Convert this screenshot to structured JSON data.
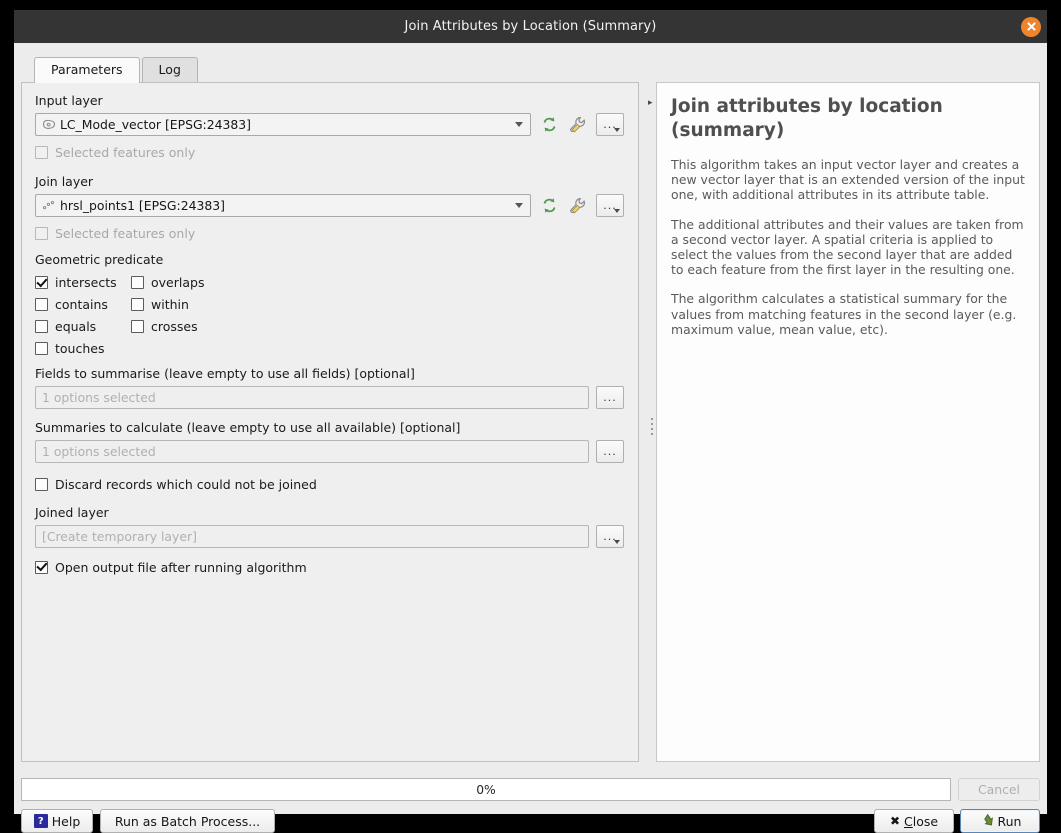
{
  "window": {
    "title": "Join Attributes by Location (Summary)",
    "close_icon": "close-icon"
  },
  "tabs": [
    {
      "label": "Parameters",
      "active": true
    },
    {
      "label": "Log",
      "active": false
    }
  ],
  "parameters": {
    "input_layer": {
      "label": "Input layer",
      "value": "LC_Mode_vector [EPSG:24383]",
      "layer_icon": "polygon-layer-icon",
      "refresh_icon": "refresh-icon",
      "wrench_icon": "wrench-icon",
      "more_label": "..."
    },
    "input_selected_only": {
      "label": "Selected features only",
      "checked": false,
      "disabled": true
    },
    "join_layer": {
      "label": "Join layer",
      "value": "hrsl_points1 [EPSG:24383]",
      "layer_icon": "point-layer-icon",
      "refresh_icon": "refresh-icon",
      "wrench_icon": "wrench-icon",
      "more_label": "..."
    },
    "join_selected_only": {
      "label": "Selected features only",
      "checked": false,
      "disabled": true
    },
    "geometric_predicate": {
      "label": "Geometric predicate",
      "options": [
        {
          "label": "intersects",
          "checked": true
        },
        {
          "label": "overlaps",
          "checked": false
        },
        {
          "label": "contains",
          "checked": false
        },
        {
          "label": "within",
          "checked": false
        },
        {
          "label": "equals",
          "checked": false
        },
        {
          "label": "crosses",
          "checked": false
        },
        {
          "label": "touches",
          "checked": false
        }
      ]
    },
    "fields_to_summarise": {
      "label": "Fields to summarise (leave empty to use all fields) [optional]",
      "value": "1 options selected",
      "more_label": "..."
    },
    "summaries_to_calculate": {
      "label": "Summaries to calculate (leave empty to use all available) [optional]",
      "value": "1 options selected",
      "more_label": "..."
    },
    "discard_records": {
      "label": "Discard records which could not be joined",
      "checked": false
    },
    "joined_layer": {
      "label": "Joined layer",
      "value": "[Create temporary layer]",
      "more_label": "..."
    },
    "open_output": {
      "label": "Open output file after running algorithm",
      "checked": true
    }
  },
  "help": {
    "title": "Join attributes by location (summary)",
    "paragraphs": [
      "This algorithm takes an input vector layer and creates a new vector layer that is an extended version of the input one, with additional attributes in its attribute table.",
      "The additional attributes and their values are taken from a second vector layer. A spatial criteria is applied to select the values from the second layer that are added to each feature from the first layer in the resulting one.",
      "The algorithm calculates a statistical summary for the values from matching features in the second layer (e.g. maximum value, mean value, etc)."
    ]
  },
  "footer": {
    "progress_text": "0%",
    "progress_value": 0,
    "cancel_label": "Cancel",
    "help_label": "Help",
    "batch_label": "Run as Batch Process...",
    "close_label": "Close",
    "run_label": "Run"
  },
  "colors": {
    "titlebar": "#343434",
    "close_button": "#f0842a",
    "dialog_bg": "#ececec",
    "accent_focus": "#5a86b5",
    "refresh_icon": "#4f9a4f",
    "run_icon": "#5f7a32"
  }
}
